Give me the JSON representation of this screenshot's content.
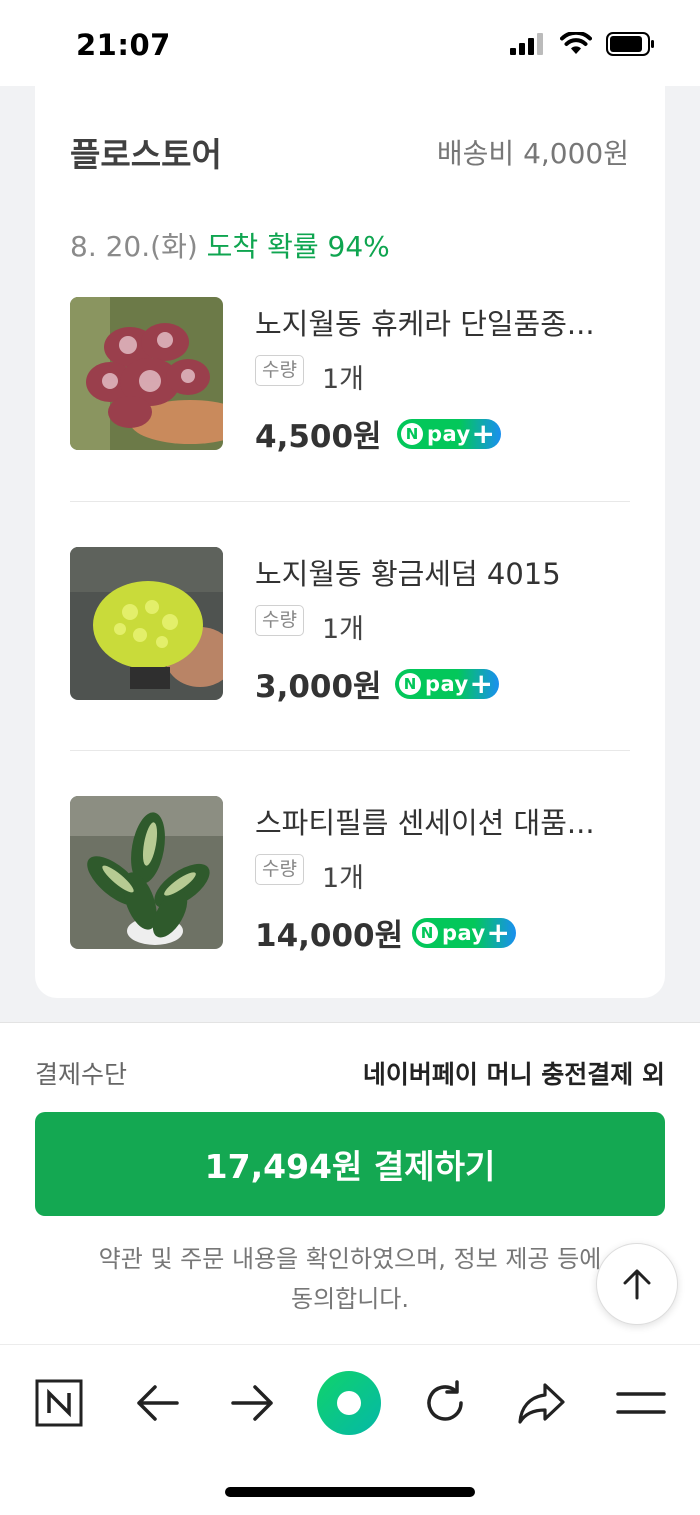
{
  "status_bar": {
    "time": "21:07"
  },
  "store": {
    "name": "플로스토어",
    "shipping": "배송비 4,000원",
    "arrival_date": "8. 20.(화)",
    "arrival_prob": "도착 확률 94%"
  },
  "items": [
    {
      "name": "노지월동 휴케라 단일품종...",
      "qty_label": "수량",
      "qty": "1개",
      "price": "4,500원",
      "npay": "pay"
    },
    {
      "name": "노지월동 황금세덤 4015",
      "qty_label": "수량",
      "qty": "1개",
      "price": "3,000원",
      "npay": "pay"
    },
    {
      "name": "스파티필름 센세이션 대품...",
      "qty_label": "수량",
      "qty": "1개",
      "price": "14,000원",
      "npay": "pay"
    }
  ],
  "payment": {
    "method_label": "결제수단",
    "method_value": "네이버페이 머니 충전결제 외",
    "button_label": "17,494원 결제하기",
    "agreement_line1": "약관 및 주문 내용을 확인하였으며, 정보 제공 등에",
    "agreement_line2": "동의합니다."
  },
  "colors": {
    "brand_green": "#14a852",
    "npay_green": "#03c75a",
    "arrival_green": "#0fa550"
  },
  "icons": {
    "toolbar": [
      "naver-n-icon",
      "back-arrow-icon",
      "forward-arrow-icon",
      "green-dot-icon",
      "reload-icon",
      "share-icon",
      "menu-icon"
    ]
  }
}
